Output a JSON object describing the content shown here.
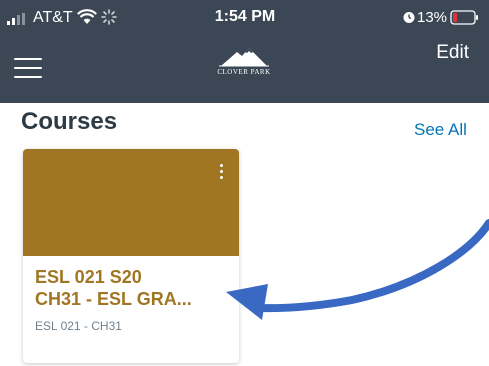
{
  "status_bar": {
    "carrier": "AT&T",
    "time": "1:54 PM",
    "battery": "13%"
  },
  "nav": {
    "logo_text": "CLOVER PARK",
    "edit_label": "Edit"
  },
  "courses": {
    "title": "Courses",
    "see_all_label": "See All",
    "cards": [
      {
        "title_line1": "ESL  021  S20",
        "title_line2": "CH31 - ESL GRA...",
        "code": "ESL  021 - CH31",
        "color": "#a07624"
      }
    ]
  },
  "colors": {
    "header_bg": "#3b4754",
    "link": "#0374b5",
    "card_accent": "#a07624",
    "annotation_arrow": "#3a69c4"
  },
  "icons": [
    "signal-icon",
    "wifi-icon",
    "activity-icon",
    "alarm-icon",
    "battery-icon",
    "hamburger-menu-icon",
    "logo-mountain-icon",
    "more-vertical-icon",
    "annotation-arrow"
  ]
}
